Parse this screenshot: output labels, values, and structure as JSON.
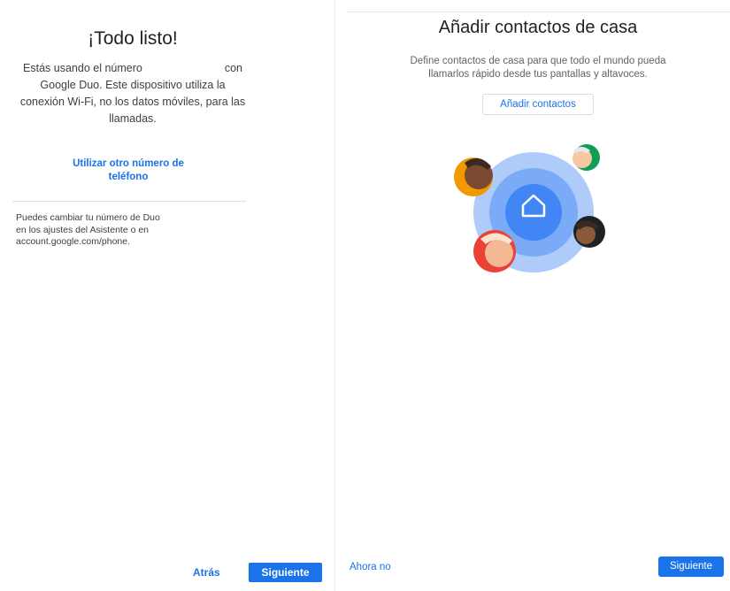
{
  "left_screen": {
    "title": "¡Todo listo!",
    "body": {
      "line1_start": "Estás usando el número",
      "line1_end": "con",
      "line2": "Google Duo. Este dispositivo utiliza la",
      "line3": "conexión Wi-Fi, no los datos móviles, para las",
      "line4": "llamadas."
    },
    "link": {
      "line1": "Utilizar otro número de",
      "line2": "teléfono"
    },
    "note": {
      "line1": "Puedes cambiar tu número de Duo",
      "line2": "en los ajustes del Asistente o en",
      "line3": "account.google.com/phone."
    },
    "back_label": "Atrás",
    "next_label": "Siguiente"
  },
  "right_screen": {
    "title": "Añadir contactos de casa",
    "description": {
      "line1": "Define contactos de casa para que todo el mundo pueda",
      "line2": "llamarlos rápido desde tus pantallas y altavoces."
    },
    "add_contacts_label": "Añadir contactos",
    "illustration_icon": "home-icon",
    "later_label": "Ahora no",
    "next_label": "Siguiente"
  },
  "colors": {
    "accent": "#1a73e8",
    "text_primary": "#202124",
    "text_secondary": "#5f6368",
    "illustration_outer": "#aecbfa",
    "illustration_mid": "#7baaf7",
    "illustration_inner": "#4285f4"
  }
}
